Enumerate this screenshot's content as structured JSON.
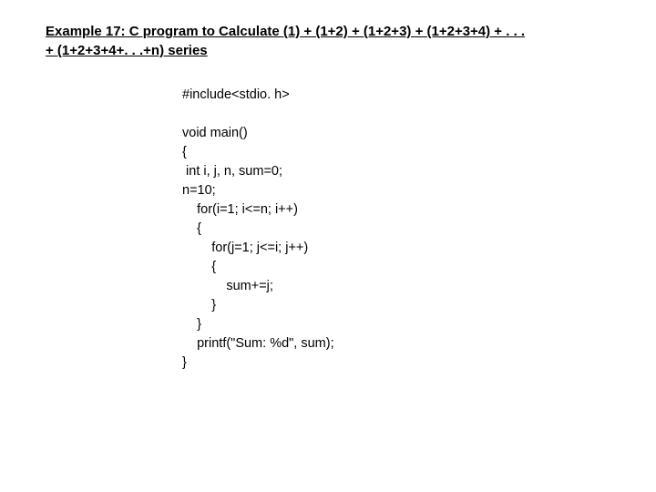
{
  "heading": {
    "line1": "Example 17: C program to Calculate (1) + (1+2) + (1+2+3) + (1+2+3+4) + . . .",
    "line2": "+ (1+2+3+4+. . .+n) series"
  },
  "code": "#include<stdio. h>\n\nvoid main()\n{\n int i, j, n, sum=0;\nn=10;\n    for(i=1; i<=n; i++)\n    {\n        for(j=1; j<=i; j++)\n        {\n            sum+=j;\n        }\n    }\n    printf(\"Sum: %d\", sum);\n}"
}
